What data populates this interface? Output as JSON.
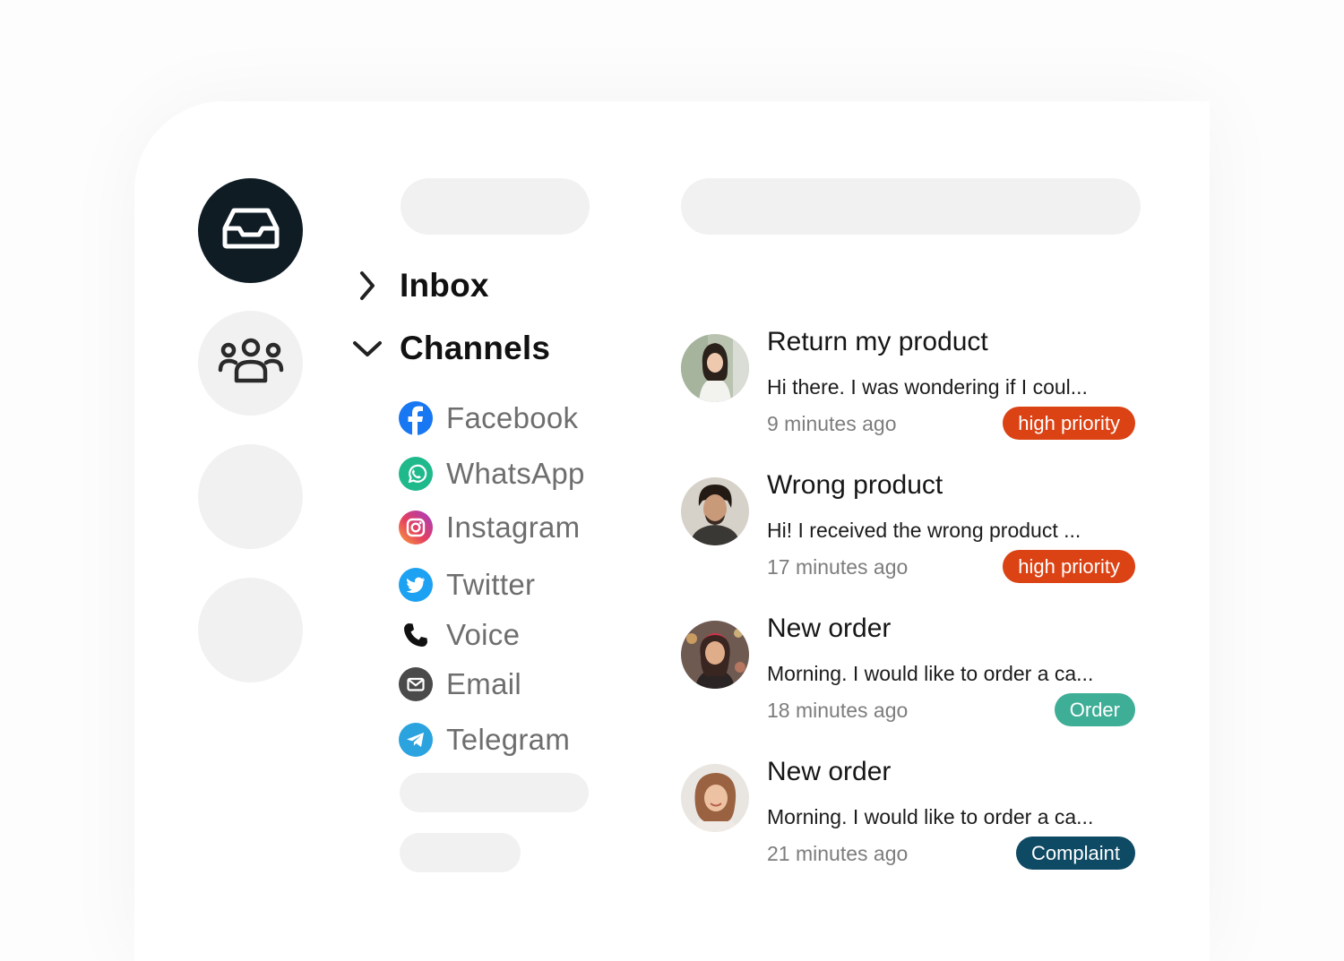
{
  "nav": {
    "inbox_label": "Inbox",
    "channels_label": "Channels",
    "channels": [
      {
        "label": "Facebook",
        "icon": "facebook-icon",
        "color": "#1877f2"
      },
      {
        "label": "WhatsApp",
        "icon": "whatsapp-icon",
        "color": "#1fb98c"
      },
      {
        "label": "Instagram",
        "icon": "instagram-icon",
        "color": "#e1306c"
      },
      {
        "label": "Twitter",
        "icon": "twitter-icon",
        "color": "#1da1f2"
      },
      {
        "label": "Voice",
        "icon": "phone-icon",
        "color": "#111111"
      },
      {
        "label": "Email",
        "icon": "email-icon",
        "color": "#4a4a4a"
      },
      {
        "label": "Telegram",
        "icon": "telegram-icon",
        "color": "#2aa3df"
      }
    ]
  },
  "conversations": [
    {
      "title": "Return my product",
      "preview": "Hi there. I was wondering if I coul...",
      "time": "9 minutes ago",
      "tag": "high priority",
      "tag_color": "#db4214"
    },
    {
      "title": "Wrong product",
      "preview": "Hi! I received the wrong product ...",
      "time": "17 minutes ago",
      "tag": "high priority",
      "tag_color": "#db4214"
    },
    {
      "title": "New order",
      "preview": "Morning. I would like to order a ca...",
      "time": "18 minutes ago",
      "tag": "Order",
      "tag_color": "#3fae96"
    },
    {
      "title": "New order",
      "preview": "Morning. I would like to order a ca...",
      "time": "21 minutes ago",
      "tag": "Complaint",
      "tag_color": "#0e4a64"
    }
  ],
  "colors": {
    "rail_active": "#0f1c24",
    "placeholder": "#f1f1f1"
  }
}
